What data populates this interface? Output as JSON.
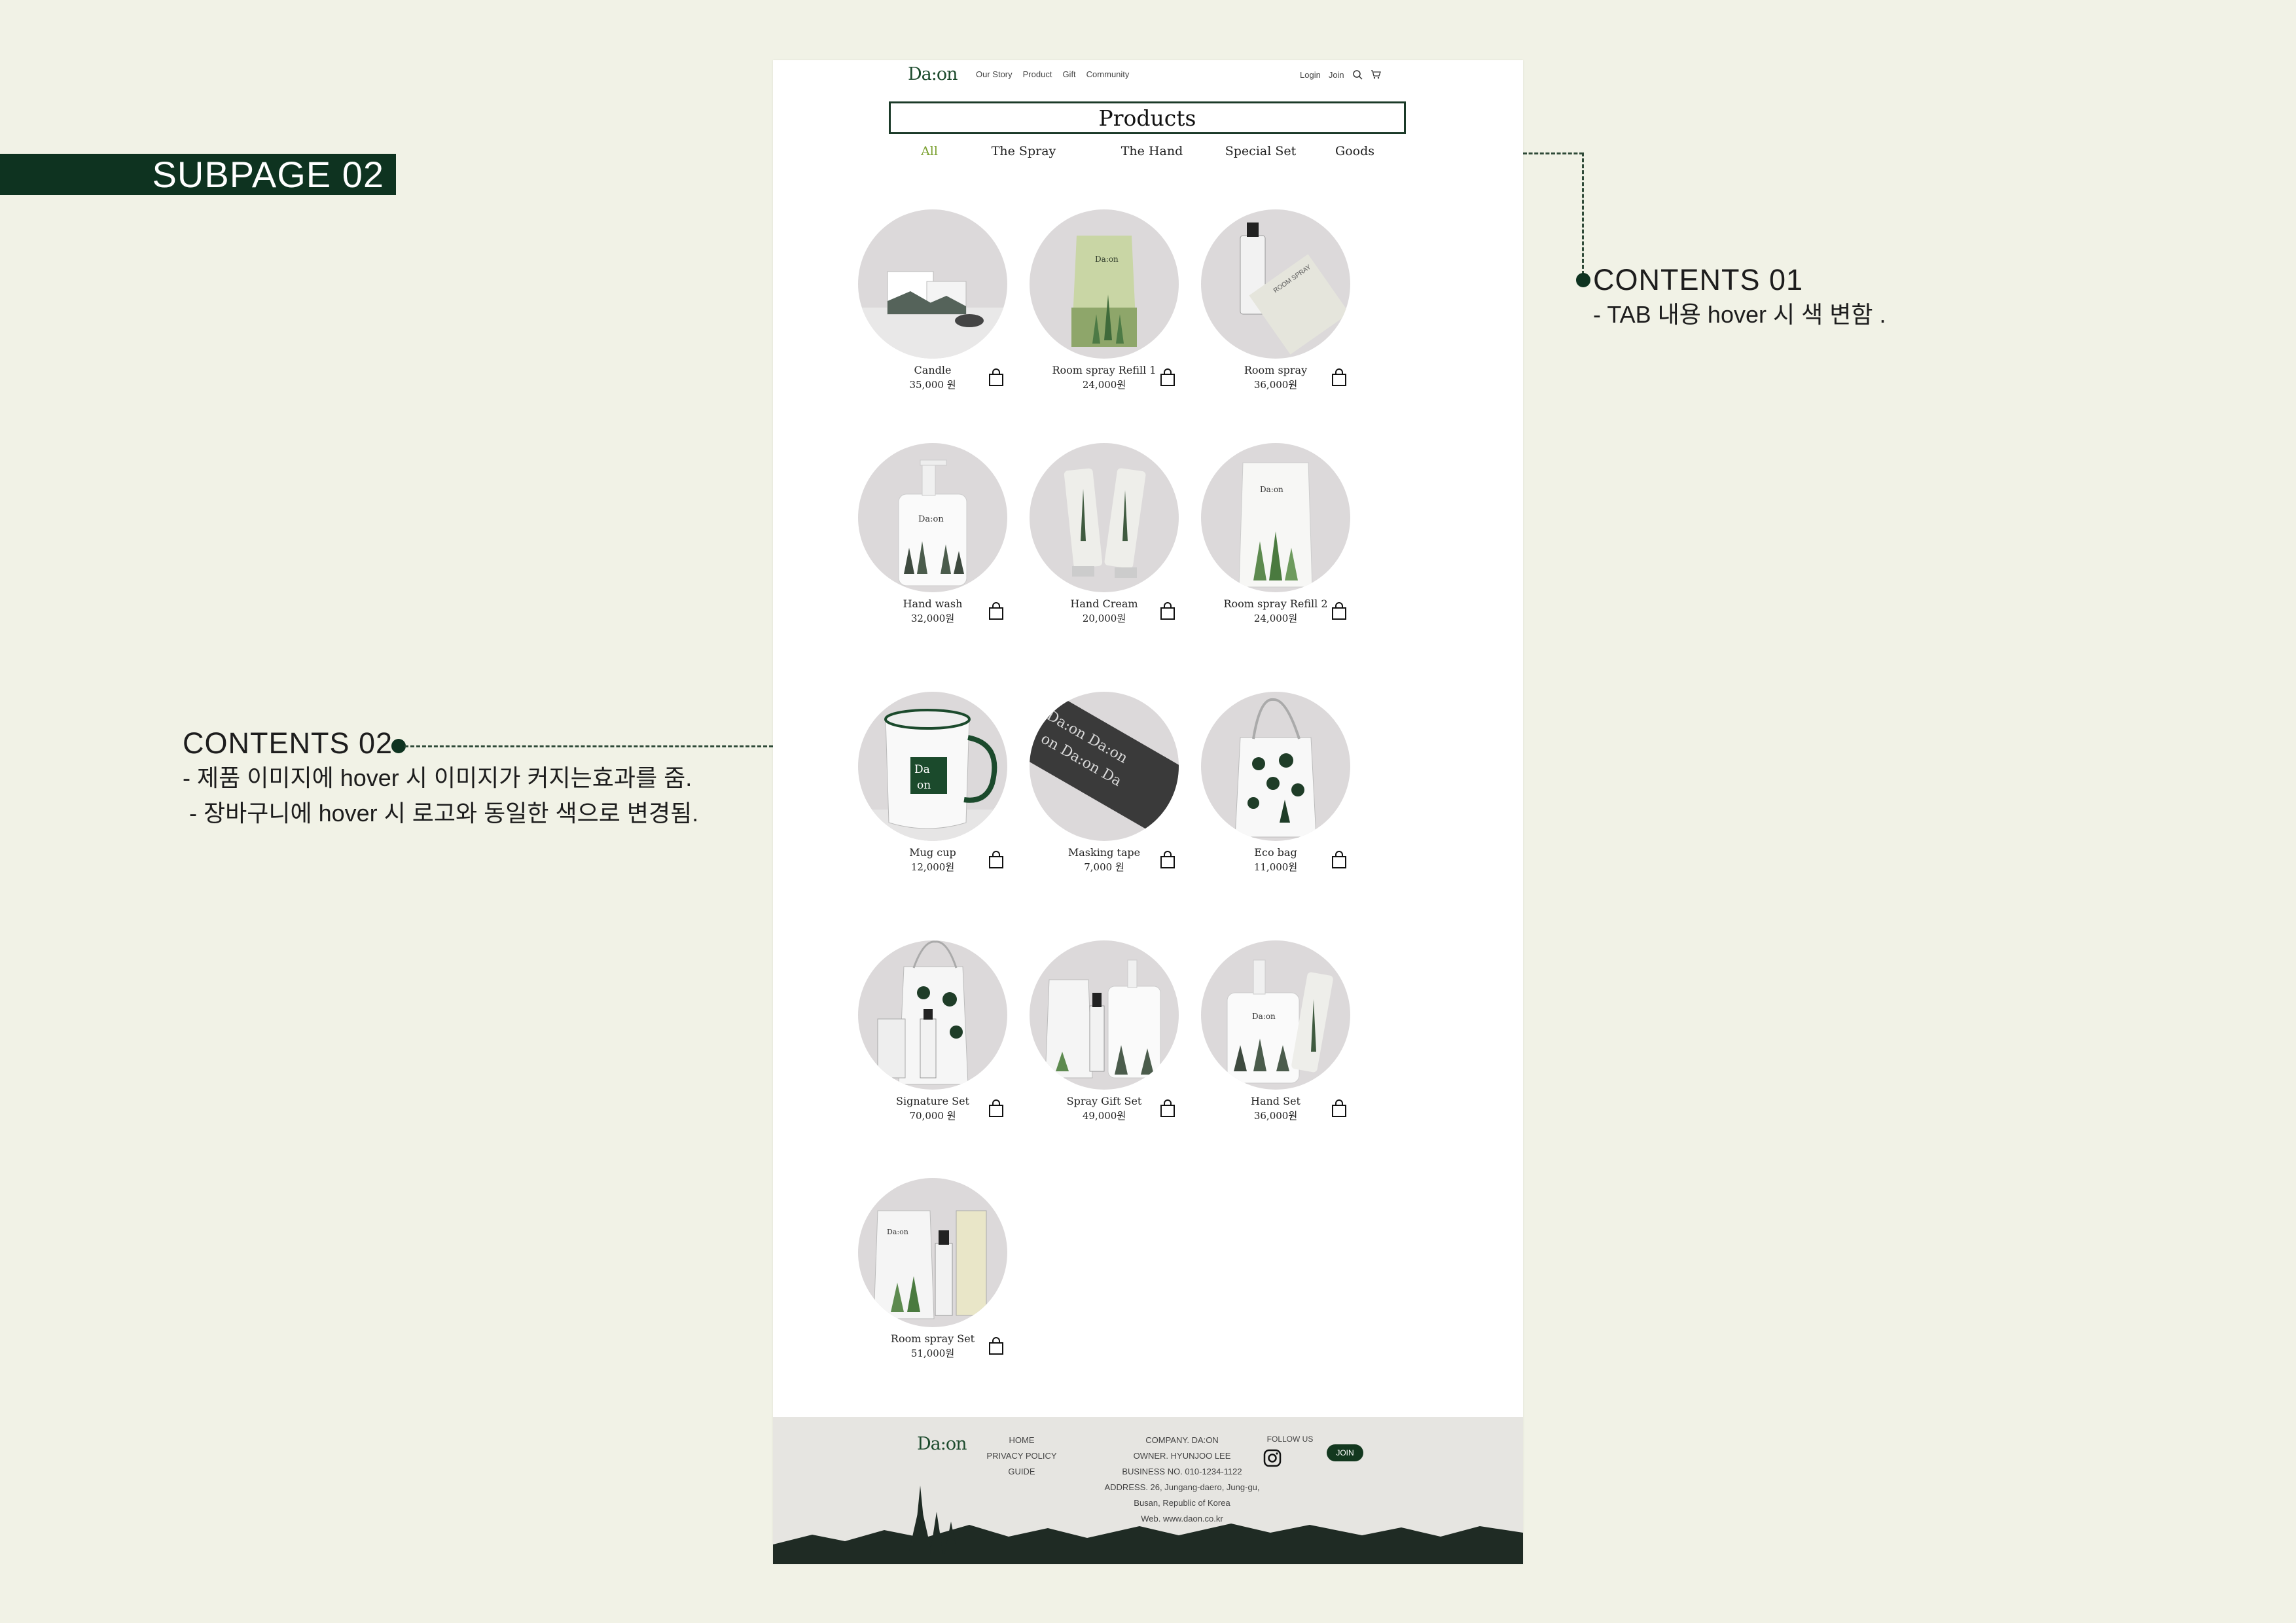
{
  "annotations": {
    "subpage_label": "SUBPAGE 02",
    "contents_01": {
      "title": "CONTENTS 01",
      "desc": "- TAB 내용 hover 시 색 변함 ."
    },
    "contents_02": {
      "title": "CONTENTS 02",
      "desc_1": "- 제품 이미지에 hover 시 이미지가 커지는효과를 줌.",
      "desc_2": " - 장바구니에 hover 시 로고와 동일한 색으로 변경됨."
    }
  },
  "nav": {
    "logo": "Da:on",
    "menu": [
      "Our Story",
      "Product",
      "Gift",
      "Community"
    ],
    "login": "Login",
    "join": "Join",
    "icons": [
      "search-icon",
      "cart-icon"
    ]
  },
  "page_title": "Products",
  "tabs": [
    {
      "label": "All",
      "active": true
    },
    {
      "label": "The Spray",
      "active": false
    },
    {
      "label": "The Hand",
      "active": false
    },
    {
      "label": "Special Set",
      "active": false
    },
    {
      "label": "Goods",
      "active": false
    }
  ],
  "products": [
    {
      "name": "Candle",
      "price": "35,000 원",
      "image": "candle"
    },
    {
      "name": "Room spray Refill 1",
      "price": "24,000원",
      "image": "pouch-green"
    },
    {
      "name": "Room spray",
      "price": "36,000원",
      "image": "spray-bottle"
    },
    {
      "name": "Hand wash",
      "price": "32,000원",
      "image": "pump-bottle"
    },
    {
      "name": "Hand Cream",
      "price": "20,000원",
      "image": "tubes"
    },
    {
      "name": "Room spray Refill 2",
      "price": "24,000원",
      "image": "pouch-white"
    },
    {
      "name": "Mug cup",
      "price": "12,000원",
      "image": "mug"
    },
    {
      "name": "Masking tape",
      "price": "7,000 원",
      "image": "tape"
    },
    {
      "name": "Eco bag",
      "price": "11,000원",
      "image": "tote"
    },
    {
      "name": "Signature Set",
      "price": "70,000 원",
      "image": "set-tote"
    },
    {
      "name": "Spray Gift Set",
      "price": "49,000원",
      "image": "set-spray"
    },
    {
      "name": "Hand Set",
      "price": "36,000원",
      "image": "set-hand"
    },
    {
      "name": "Room spray Set",
      "price": "51,000원",
      "image": "set-room"
    }
  ],
  "footer": {
    "logo": "Da:on",
    "links": [
      "HOME",
      "PRIVACY POLICY",
      "GUIDE"
    ],
    "company": [
      "COMPANY. DA:ON",
      "OWNER. HYUNJOO LEE",
      "BUSINESS NO. 010-1234-1122",
      "ADDRESS. 26, Jungang-daero, Jung-gu,",
      "Busan, Republic of Korea",
      "Web. www.daon.co.kr"
    ],
    "follow_label": "FOLLOW US",
    "join_label": "JOIN"
  },
  "colors": {
    "background": "#f1f2e6",
    "brand_green": "#0e3320",
    "tab_active": "#7aa02f",
    "thumb_bg": "#dcd9da",
    "footer_bg": "#e6e5e1"
  }
}
